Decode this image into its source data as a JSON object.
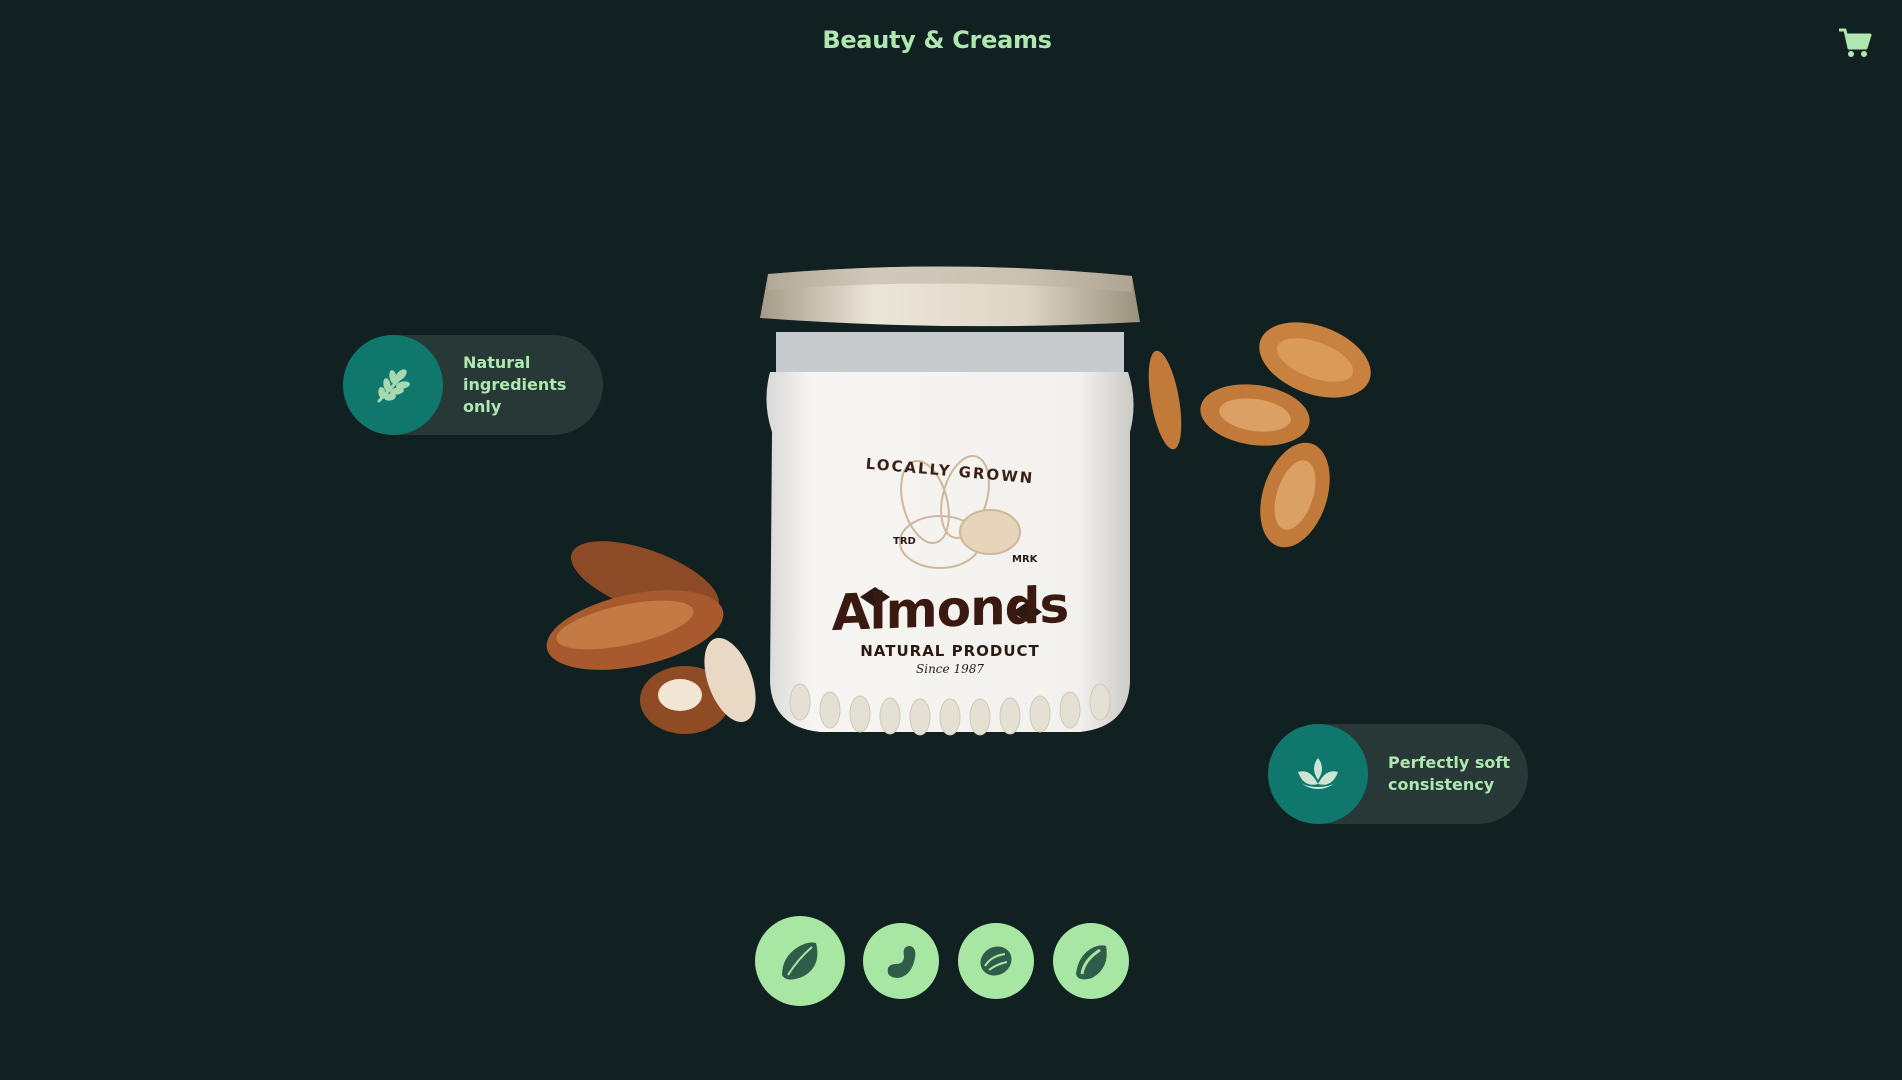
{
  "header": {
    "title": "Beauty & Creams",
    "cart_icon": "cart-icon"
  },
  "product": {
    "label_arc": "LOCALLY GROWN",
    "tag_left": "TRD",
    "tag_right": "MRK",
    "name": "Almonds",
    "subtitle": "NATURAL PRODUCT",
    "since": "Since 1987"
  },
  "features": [
    {
      "icon": "wheat-icon",
      "text": "Natural ingredients only"
    },
    {
      "icon": "lotus-icon",
      "text": "Perfectly soft consistency"
    }
  ],
  "selector": {
    "items": [
      {
        "icon": "almond-icon",
        "active": true
      },
      {
        "icon": "cashew-icon",
        "active": false
      },
      {
        "icon": "walnut-icon",
        "active": false
      },
      {
        "icon": "pistachio-icon",
        "active": false
      }
    ]
  },
  "colors": {
    "background": "#112020",
    "accent": "#aee8b0",
    "teal": "#10776d",
    "pill": "#283837",
    "selector": "#a7e6a3"
  }
}
